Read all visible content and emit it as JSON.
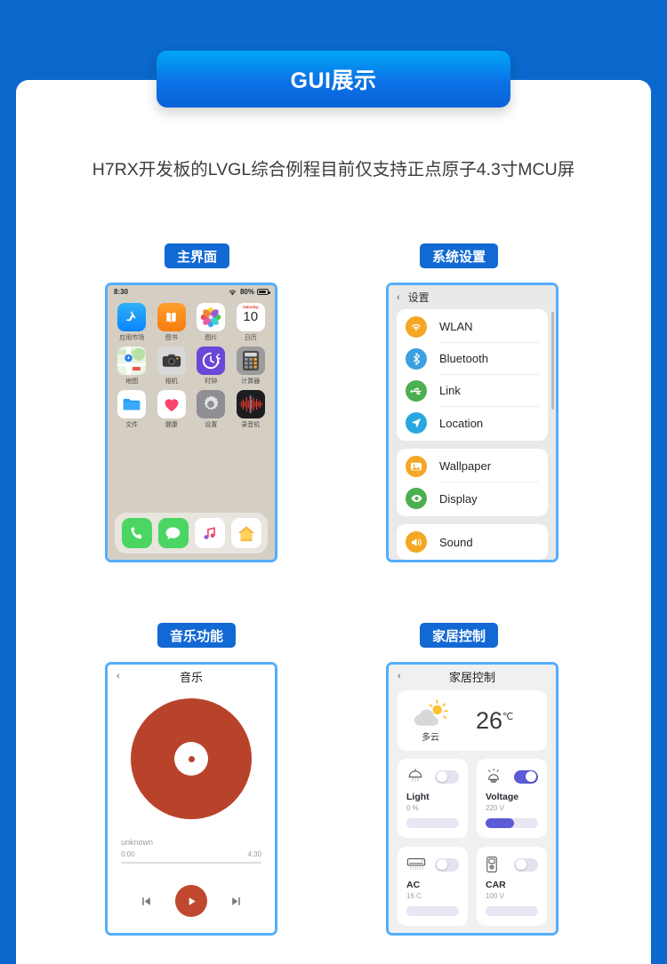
{
  "banner": {
    "title": "GUI展示"
  },
  "subtitle": "H7RX开发板的LVGL综合例程目前仅支持正点原子4.3寸MCU屏",
  "sections": {
    "home": {
      "label": "主界面"
    },
    "settings": {
      "label": "系统设置"
    },
    "music": {
      "label": "音乐功能"
    },
    "homecontrol": {
      "label": "家居控制"
    }
  },
  "home_screen": {
    "status": {
      "time": "8:30",
      "battery": "80%",
      "wifi_icon": "wifi-icon",
      "battery_icon": "battery-icon"
    },
    "apps": [
      {
        "label": "应用市场",
        "icon": "appstore-icon"
      },
      {
        "label": "图书",
        "icon": "books-icon"
      },
      {
        "label": "图片",
        "icon": "photos-icon"
      },
      {
        "label": "日历",
        "icon": "calendar-icon",
        "day_name": "Saturday",
        "day_num": "10"
      },
      {
        "label": "地图",
        "icon": "maps-icon"
      },
      {
        "label": "相机",
        "icon": "camera-icon"
      },
      {
        "label": "时钟",
        "icon": "clock-icon"
      },
      {
        "label": "计算器",
        "icon": "calculator-icon"
      },
      {
        "label": "文件",
        "icon": "files-icon"
      },
      {
        "label": "健康",
        "icon": "health-icon"
      },
      {
        "label": "设置",
        "icon": "settings-gear-icon"
      },
      {
        "label": "录音机",
        "icon": "voice-memos-icon"
      }
    ],
    "dock": [
      {
        "label": "Phone",
        "icon": "phone-icon"
      },
      {
        "label": "Messages",
        "icon": "messages-icon"
      },
      {
        "label": "Music",
        "icon": "music-note-icon"
      },
      {
        "label": "Home",
        "icon": "home-icon"
      }
    ]
  },
  "settings_screen": {
    "title": "设置",
    "back_icon": "chevron-left-icon",
    "groups": [
      {
        "items": [
          {
            "label": "WLAN",
            "icon": "wifi-icon",
            "color": "#f5a623"
          },
          {
            "label": "Bluetooth",
            "icon": "bluetooth-icon",
            "color": "#3aa0e0"
          },
          {
            "label": "Link",
            "icon": "usb-icon",
            "color": "#4caf50"
          },
          {
            "label": "Location",
            "icon": "location-icon",
            "color": "#29a8e0"
          }
        ]
      },
      {
        "items": [
          {
            "label": "Wallpaper",
            "icon": "image-icon",
            "color": "#f5a623"
          },
          {
            "label": "Display",
            "icon": "eye-icon",
            "color": "#4caf50"
          }
        ]
      },
      {
        "items": [
          {
            "label": "Sound",
            "icon": "speaker-icon",
            "color": "#f5a623"
          }
        ]
      }
    ]
  },
  "music_screen": {
    "title": "音乐",
    "back_icon": "chevron-left-icon",
    "track": "unknown",
    "elapsed": "0:00",
    "duration": "4:30",
    "progress_pct": 0,
    "disc_color": "#b8432a",
    "controls": {
      "prev": "previous-track-icon",
      "play": "play-icon",
      "next": "next-track-icon"
    }
  },
  "home_control_screen": {
    "title": "家居控制",
    "back_icon": "chevron-left-icon",
    "weather": {
      "condition": "多云",
      "icon": "partly-cloudy-icon",
      "temperature": "26",
      "unit": "℃"
    },
    "devices": [
      {
        "name": "Light",
        "value": "0 %",
        "icon": "lamp-icon",
        "on": false,
        "slider_pct": 0
      },
      {
        "name": "Voltage",
        "value": "220 V",
        "icon": "bulb-icon",
        "on": true,
        "slider_pct": 55
      },
      {
        "name": "AC",
        "value": "16 C",
        "icon": "ac-icon",
        "on": false,
        "slider_pct": 0
      },
      {
        "name": "CAR",
        "value": "100 V",
        "icon": "charger-icon",
        "on": false,
        "slider_pct": 0
      }
    ]
  },
  "colors": {
    "page_bg": "#0b68cc",
    "card_bg": "#ffffff",
    "pill": "#1269d3",
    "frame_border": "#54aefc",
    "accent_purple": "#5b5bd6"
  }
}
